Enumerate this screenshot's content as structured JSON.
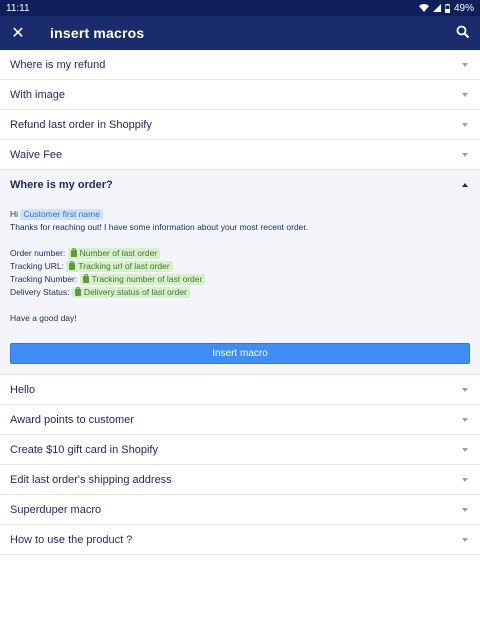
{
  "status_bar": {
    "time": "11:11",
    "battery": "49%"
  },
  "app_bar": {
    "title": "insert macros",
    "close_icon": "close-icon",
    "search_icon": "search-icon"
  },
  "macros_top": [
    {
      "label": "Where is my refund"
    },
    {
      "label": "With image"
    },
    {
      "label": "Refund last order in Shoppify"
    },
    {
      "label": "Waive Fee"
    }
  ],
  "expanded": {
    "title": "Where is my order?",
    "greeting": "Hi",
    "customer_tag": "Customer first name",
    "intro": "Thanks for reaching out! I have some information about your most recent order.",
    "fields": [
      {
        "label": "Order number:",
        "tag": "Number of last order"
      },
      {
        "label": "Tracking URL:",
        "tag": "Tracking url of last order"
      },
      {
        "label": "Tracking Number:",
        "tag": "Tracking number of last order"
      },
      {
        "label": "Delivery Status:",
        "tag": "Delivery status of last order"
      }
    ],
    "closing": "Have a good day!",
    "button": "Insert macro"
  },
  "macros_bottom": [
    {
      "label": "Hello"
    },
    {
      "label": "Award points to customer"
    },
    {
      "label": "Create $10 gift card in Shopify"
    },
    {
      "label": "Edit last order's shipping address"
    },
    {
      "label": "Superduper macro"
    },
    {
      "label": "How to use the product ?"
    }
  ],
  "colors": {
    "app_bar": "#1a2c6c",
    "status_bar": "#0e1f5b",
    "button": "#3f8ef5",
    "tag_blue": "#cfe1fb",
    "tag_green": "#d8efcc"
  }
}
